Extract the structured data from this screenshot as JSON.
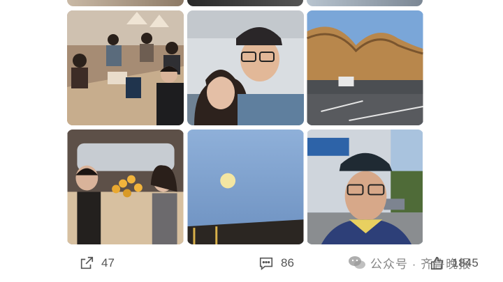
{
  "photos": [
    {
      "label": ""
    },
    {
      "label": ""
    },
    {
      "label": ""
    },
    {
      "label": ""
    },
    {
      "label": ""
    },
    {
      "label": ""
    }
  ],
  "actions": {
    "share_count": "47",
    "comment_count": "86",
    "like_count": "1845"
  },
  "watermark": {
    "text": "公众号 · 齐鲁晚报",
    "icon": "wechat-icon"
  },
  "icons": {
    "share": "share-icon",
    "comment": "comment-icon",
    "like": "thumbs-up-icon"
  },
  "colors": {
    "text_gray": "#555555",
    "sky_blue": "#7aa6d8"
  }
}
